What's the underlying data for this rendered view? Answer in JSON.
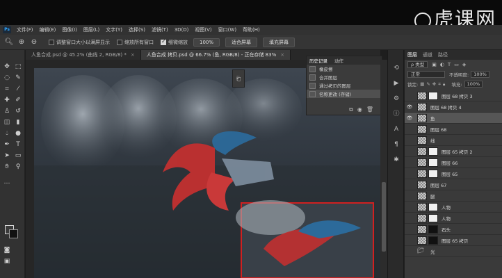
{
  "watermark": {
    "text": "虎课网"
  },
  "menubar": {
    "logo": "Ps",
    "items": [
      "文件(F)",
      "编辑(E)",
      "图像(I)",
      "图层(L)",
      "文字(Y)",
      "选择(S)",
      "滤镜(T)",
      "3D(D)",
      "视图(V)",
      "窗口(W)",
      "帮助(H)"
    ]
  },
  "options": {
    "checkbox1": "调整窗口大小以满屏显示",
    "checkbox2": "缩放所有窗口",
    "checkbox3": "细微缩放",
    "zoom_btn": "100%",
    "fit_btn": "适合屏幕",
    "fill_btn": "填充屏幕"
  },
  "tabs": [
    {
      "label": "人鱼合成.psd @ 45.2% (曲线 2, RGB/8) *",
      "close": "×"
    },
    {
      "label": "人鱼合成 拷贝.psd @ 66.7% (鱼, RGB/8) - 正在存储 83%",
      "close": "×"
    }
  ],
  "history": {
    "tab_history": "历史记录",
    "tab_actions": "动作",
    "items": [
      "橡皮擦",
      "合并图层",
      "通过拷贝的图层",
      "名称更改 (存储)"
    ]
  },
  "layers_panel": {
    "tab_layers": "图层",
    "tab_channels": "通道",
    "tab_paths": "路径",
    "filter_kind": "ρ 类型",
    "blend_mode": "正常",
    "opacity_label": "不透明度:",
    "opacity": "100%",
    "lock_label": "锁定:",
    "fill_label": "填充:",
    "fill": "100%",
    "layers": [
      {
        "name": "图层 68 拷贝 3",
        "visible": false,
        "mask": "light"
      },
      {
        "name": "图层 68 拷贝 4",
        "visible": true,
        "mask": ""
      },
      {
        "name": "鱼",
        "visible": true,
        "mask": ""
      },
      {
        "name": "图层 68",
        "visible": false,
        "mask": ""
      },
      {
        "name": "线",
        "visible": false,
        "mask": ""
      },
      {
        "name": "图层 65 拷贝 2",
        "visible": false,
        "mask": "light"
      },
      {
        "name": "图层 66",
        "visible": false,
        "mask": "light"
      },
      {
        "name": "图层 65",
        "visible": false,
        "mask": "light"
      },
      {
        "name": "图层 67",
        "visible": false,
        "mask": ""
      },
      {
        "name": "腿",
        "visible": false,
        "mask": ""
      },
      {
        "name": "人物",
        "visible": false,
        "mask": "light"
      },
      {
        "name": "人物",
        "visible": false,
        "mask": "light"
      },
      {
        "name": "石头",
        "visible": false,
        "mask": "dark"
      },
      {
        "name": "图层 65 拷贝",
        "visible": false,
        "mask": "dark"
      },
      {
        "name": "光",
        "visible": false,
        "mask": "",
        "folder": true
      }
    ]
  }
}
